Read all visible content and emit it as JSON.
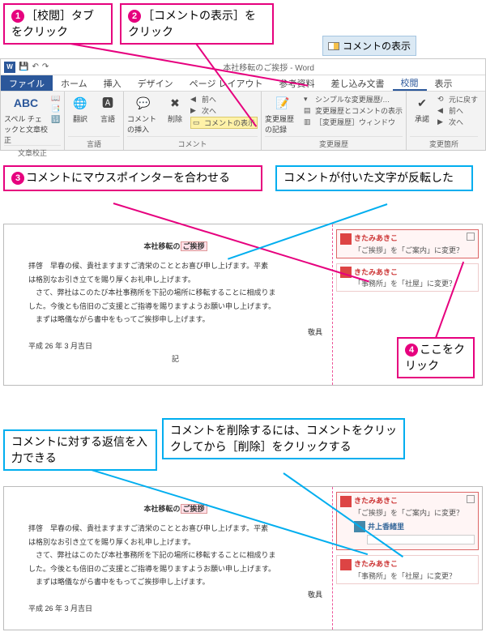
{
  "callouts": {
    "c1": {
      "num": "1",
      "text": "［校閲］タブをクリック"
    },
    "c2": {
      "num": "2",
      "text": "［コメントの表示］をクリック"
    },
    "c3": {
      "num": "3",
      "text": "コメントにマウスポインターを合わせる"
    },
    "c4": {
      "text": "コメントが付いた文字が反転した"
    },
    "c5": {
      "num": "4",
      "text": "ここをクリック"
    },
    "c6": {
      "text": "コメントに対する返信を入力できる"
    },
    "c7": {
      "text": "コメントを削除するには、コメントをクリックしてから［削除］をクリックする"
    }
  },
  "floating_button": {
    "label": "コメントの表示"
  },
  "window": {
    "title": "本社移転のご挨拶 - Word",
    "qat": [
      "↶",
      "↷"
    ]
  },
  "tabs": {
    "file": "ファイル",
    "items": [
      "ホーム",
      "挿入",
      "デザイン",
      "ページ レイアウト",
      "参考資料",
      "差し込み文書",
      "校閲",
      "表示"
    ],
    "active": "校閲"
  },
  "ribbon": {
    "proofing": {
      "btn1": "スペル チェックと文章校正",
      "label": "文章校正",
      "abc": "ABC"
    },
    "language": {
      "btn1": "翻訳",
      "btn2": "言語",
      "label": "言語"
    },
    "comments": {
      "new": "コメントの挿入",
      "delete": "削除",
      "prev": "前へ",
      "next": "次へ",
      "show": "コメントの表示",
      "label": "コメント"
    },
    "tracking": {
      "track": "変更履歴の記録",
      "markup1": "シンプルな変更履歴/…",
      "markup2": "変更履歴とコメントの表示",
      "markup3": "［変更履歴］ウィンドウ",
      "label": "変更履歴"
    },
    "changes": {
      "accept": "承諾",
      "revert": "元に戻す",
      "prev": "前へ",
      "next": "次へ",
      "label": "変更箇所"
    }
  },
  "document": {
    "heading_pre": "本社移転の",
    "heading_mark": "ご挨拶",
    "body1": "拝啓　早春の候、貴社ますますご清栄のこととお喜び申し上げます。平素",
    "body2": "は格別なお引き立てを賜り厚くお礼申し上げます。",
    "body3": "　さて、弊社はこのたび本社事務所を下記の場所に移転することに相成りま",
    "body4": "した。今後とも倍旧のご支援とご指導を賜りますようお願い申し上げます。",
    "body5": "　まずは略儀ながら書中をもってご挨拶申し上げます。",
    "closing": "敬具",
    "date": "平成 26 年 3 月吉日",
    "sep": "記"
  },
  "comments": {
    "author": "きたみあきこ",
    "c1_text": "「ご挨拶」を「ご案内」に変更？",
    "c2_text": "「事務所」を「社屋」に変更？",
    "reply_author": "井上香緒里"
  }
}
